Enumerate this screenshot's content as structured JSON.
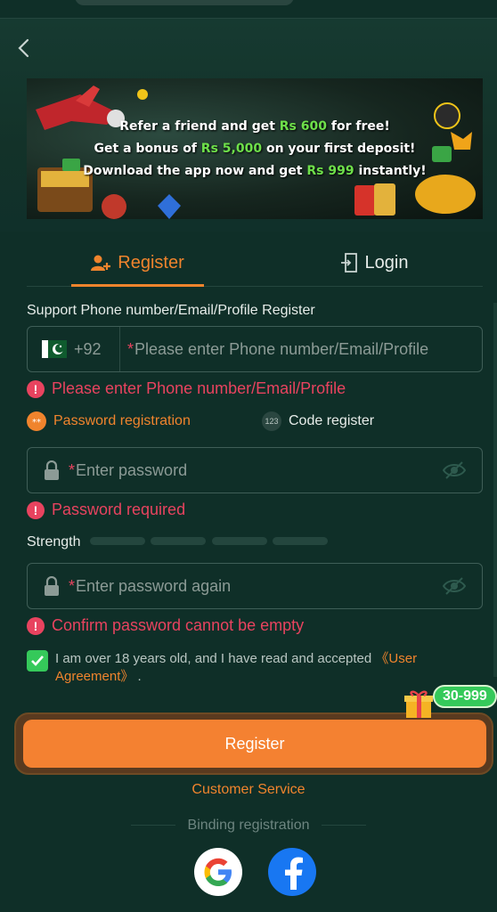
{
  "banner": {
    "line1_pre": "Refer a friend and get ",
    "line1_hl": "Rs 600",
    "line1_post": " for free!",
    "line2_pre": "Get a bonus of ",
    "line2_hl": "Rs 5,000",
    "line2_post": " on your first deposit!",
    "line3_pre": "Download the app now and get ",
    "line3_hl": "Rs 999",
    "line3_post": " instantly!"
  },
  "tabs": {
    "register": "Register",
    "login": "Login"
  },
  "form": {
    "account_label": "Support Phone number/Email/Profile Register",
    "country_code": "+92",
    "required_mark": "*",
    "account_placeholder": "Please enter Phone number/Email/Profile",
    "account_error": "Please enter Phone number/Email/Profile",
    "mode_password": "Password registration",
    "mode_code": "Code register",
    "mode_code_icon_text": "123",
    "password_placeholder": "Enter password",
    "password_error": "Password required",
    "strength_label": "Strength",
    "confirm_placeholder": "Enter password again",
    "confirm_error": "Confirm password cannot be empty",
    "agree_text": "I am over 18 years old, and I have read and accepted ",
    "agree_link": "《User Agreement》",
    "agree_tail": " .",
    "register_button": "Register",
    "gift_badge": "30-999"
  },
  "footer": {
    "customer_service": "Customer Service",
    "binding": "Binding registration"
  },
  "colors": {
    "accent": "#f48131",
    "error": "#e8435f",
    "success": "#35c95a",
    "bg": "#0f2f28"
  },
  "icons": [
    "back-arrow-icon",
    "user-plus-icon",
    "login-door-icon",
    "pakistan-flag-icon",
    "error-icon",
    "lock-icon",
    "eye-off-icon",
    "check-icon",
    "gift-icon",
    "google-icon",
    "facebook-icon"
  ]
}
